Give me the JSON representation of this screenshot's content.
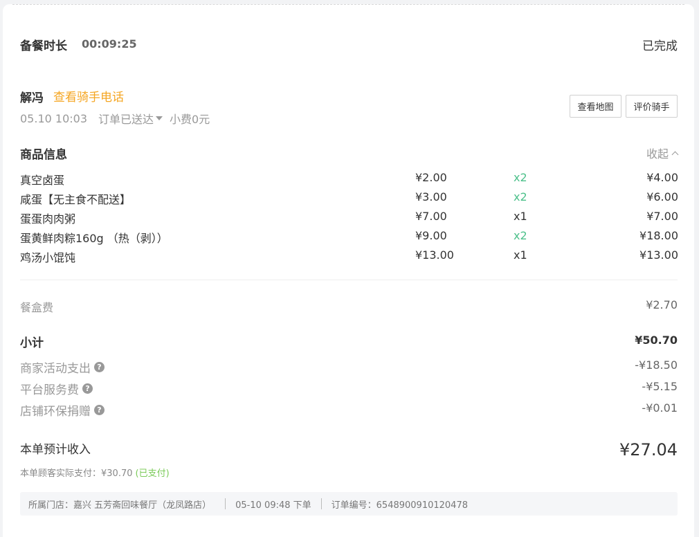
{
  "header": {
    "prep_label": "备餐时长",
    "prep_time": "00:09:25",
    "status": "已完成"
  },
  "rider": {
    "name": "解冯",
    "phone_link": "查看骑手电话",
    "time": "05.10 10:03",
    "delivery_status": "订单已送达",
    "tip": "小费0元",
    "map_button": "查看地图",
    "rate_button": "评价骑手"
  },
  "goods": {
    "title": "商品信息",
    "collapse": "收起",
    "items": [
      {
        "name": "真空卤蛋",
        "price": "¥2.00",
        "qty": "x2",
        "total": "¥4.00"
      },
      {
        "name": "咸蛋【无主食不配送】",
        "price": "¥3.00",
        "qty": "x2",
        "total": "¥6.00"
      },
      {
        "name": "蛋蛋肉肉粥",
        "price": "¥7.00",
        "qty": "x1",
        "total": "¥7.00"
      },
      {
        "name": "蛋黄鲜肉粽160g （热（剥））",
        "price": "¥9.00",
        "qty": "x2",
        "total": "¥18.00"
      },
      {
        "name": "鸡汤小馄饨",
        "price": "¥13.00",
        "qty": "x1",
        "total": "¥13.00"
      }
    ]
  },
  "fees": {
    "box_label": "餐盒费",
    "box_value": "¥2.70",
    "subtotal_label": "小计",
    "subtotal_value": "¥50.70",
    "deductions": [
      {
        "label": "商家活动支出",
        "value": "-¥18.50"
      },
      {
        "label": "平台服务费",
        "value": "-¥5.15"
      },
      {
        "label": "店铺环保捐赠",
        "value": "-¥0.01"
      }
    ]
  },
  "income": {
    "label": "本单预计收入",
    "value": "¥27.04",
    "paid_text": "本单顾客实际支付：¥30.70",
    "paid_status": "(已支付)"
  },
  "footer": {
    "store": "所属门店：嘉兴 五芳斋回味餐厅（龙凤路店）",
    "order_time": "05-10 09:48 下单",
    "order_no": "订单编号：6548900910120478"
  },
  "colors": {
    "accent_orange": "#f5a623",
    "qty_green": "#4cc08a",
    "paid_green": "#7ccb5a"
  },
  "icons": {
    "help": "question-circle-icon",
    "caret": "caret-down-icon",
    "collapse": "chevron-up-icon"
  }
}
